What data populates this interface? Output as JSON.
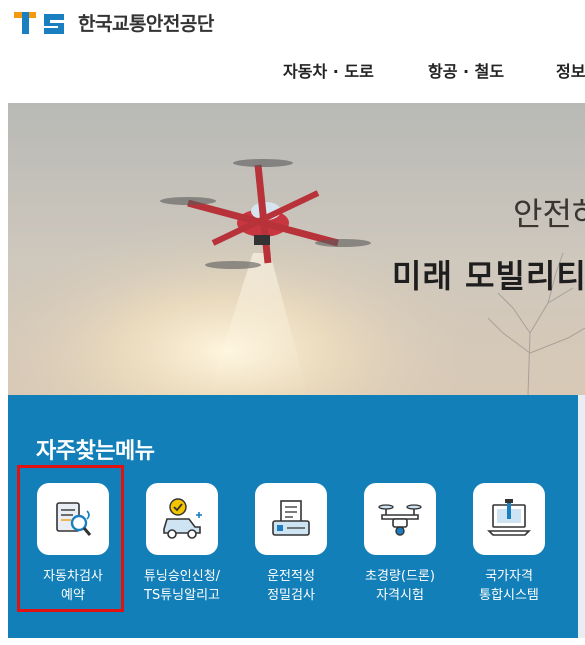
{
  "header": {
    "logo_mark": "TS",
    "logo_text": "한국교통안전공단",
    "nav": [
      "자동차 · 도로",
      "항공 · 철도",
      "정보"
    ]
  },
  "hero": {
    "subtitle": "안전하",
    "title": "미래 모빌리티"
  },
  "quick_menu": {
    "title": "자주찾는메뉴",
    "items": [
      {
        "line1": "자동차검사",
        "line2": "예약",
        "icon": "vehicle-inspection-icon"
      },
      {
        "line1": "튜닝승인신청/",
        "line2": "TS튜닝알리고",
        "icon": "tuning-car-icon"
      },
      {
        "line1": "운전적성",
        "line2": "정밀검사",
        "icon": "aptitude-test-icon"
      },
      {
        "line1": "초경량(드론)",
        "line2": "자격시험",
        "icon": "drone-icon"
      },
      {
        "line1": "국가자격",
        "line2": "통합시스템",
        "icon": "certification-system-icon"
      }
    ]
  },
  "colors": {
    "quick_bg": "#137fb8",
    "highlight": "#e01212",
    "logo_orange": "#f39a12",
    "logo_blue": "#1a7fc1"
  }
}
